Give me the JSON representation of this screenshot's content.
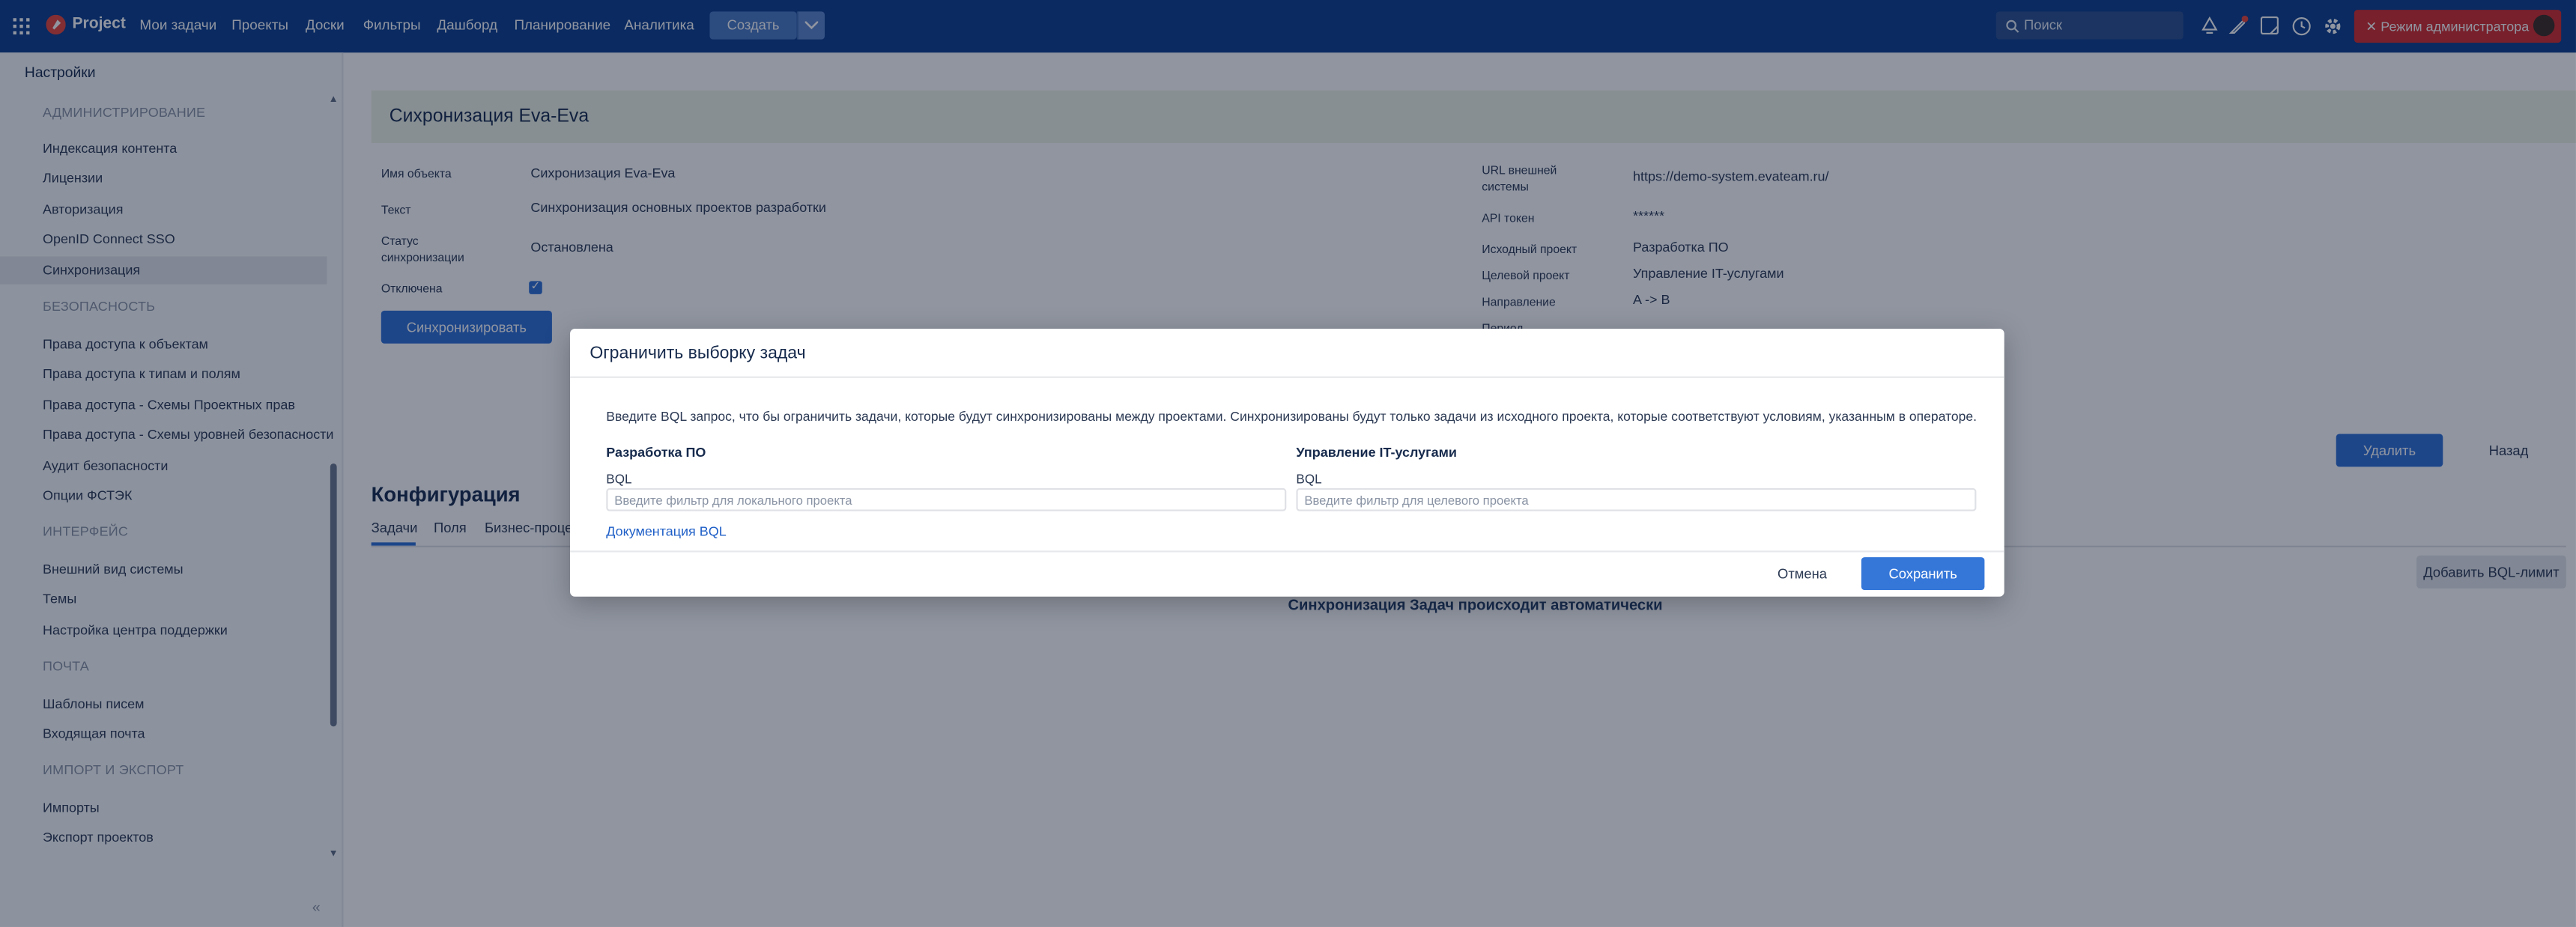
{
  "topbar": {
    "logo_text": "Project",
    "nav": [
      "Мои задачи",
      "Проекты",
      "Доски",
      "Фильтры",
      "Дашборд",
      "Планирование",
      "Аналитика"
    ],
    "create_label": "Создать",
    "search_placeholder": "Поиск",
    "admin_label": "Режим администратора"
  },
  "sidebar": {
    "title": "Настройки",
    "sections": [
      {
        "heading": "АДМИНИСТРИРОВАНИЕ",
        "items": [
          "Индексация контента",
          "Лицензии",
          "Авторизация",
          "OpenID Connect SSO",
          "Синхронизация"
        ]
      },
      {
        "heading": "БЕЗОПАСНОСТЬ",
        "items": [
          "Права доступа к объектам",
          "Права доступа к типам и полям",
          "Права доступа - Схемы Проектных прав",
          "Права доступа - Схемы уровней безопасности",
          "Аудит безопасности",
          "Опции ФСТЭК"
        ]
      },
      {
        "heading": "ИНТЕРФЕЙС",
        "items": [
          "Внешний вид системы",
          "Темы",
          "Настройка центра поддержки"
        ]
      },
      {
        "heading": "ПОЧТА",
        "items": [
          "Шаблоны писем",
          "Входящая почта"
        ]
      },
      {
        "heading": "ИМПОРТ И ЭКСПОРТ",
        "items": [
          "Импорты",
          "Экспорт проектов"
        ]
      }
    ],
    "active_item": "Синхронизация"
  },
  "details": {
    "page_title": "Сихронизация Eva-Eva",
    "left": [
      {
        "label": "Имя объекта",
        "value": "Сихронизация Eva-Eva"
      },
      {
        "label": "Текст",
        "value": "Синхронизация основных проектов разработки"
      },
      {
        "label": "Статус синхронизации",
        "value": "Остановлена"
      },
      {
        "label": "Отключена",
        "value": ""
      }
    ],
    "disabled_checked": true,
    "right": [
      {
        "label": "URL внешней системы",
        "value": "https://demo-system.evateam.ru/"
      },
      {
        "label": "API токен",
        "value": "******"
      },
      {
        "label": "Исходный проект",
        "value": "Разработка ПО"
      },
      {
        "label": "Целевой проект",
        "value": "Управление IT-услугами"
      },
      {
        "label": "Направление",
        "value": "A -> B"
      },
      {
        "label": "Период",
        "value": ""
      }
    ],
    "sync_button": "Синхронизировать",
    "delete_button": "Удалить",
    "back_link": "Назад"
  },
  "config": {
    "title": "Конфигурация",
    "tabs": [
      "Задачи",
      "Поля",
      "Бизнес-проце"
    ],
    "add_bql_button": "Добавить BQL-лимит",
    "auto_text": "Синхронизация Задач происходит автоматически"
  },
  "modal": {
    "title": "Ограничить выборку задач",
    "description": "Введите BQL запрос, что бы ограничить задачи, которые будут синхронизированы между проектами. Синхронизированы будут только задачи из исходного проекта, которые соответствуют условиям, указанным в операторе.",
    "left_project": "Разработка ПО",
    "right_project": "Управление IT-услугами",
    "bql_label": "BQL",
    "left_placeholder": "Введите фильтр для локального проекта",
    "right_placeholder": "Введите фильтр для целевого проекта",
    "doc_link": "Документация BQL",
    "cancel": "Отмена",
    "save": "Сохранить"
  },
  "colors": {
    "topbar": "#0b3c8c",
    "primary": "#2f6fd6",
    "admin": "#d42b2b",
    "banner": "#f0f4e6"
  }
}
